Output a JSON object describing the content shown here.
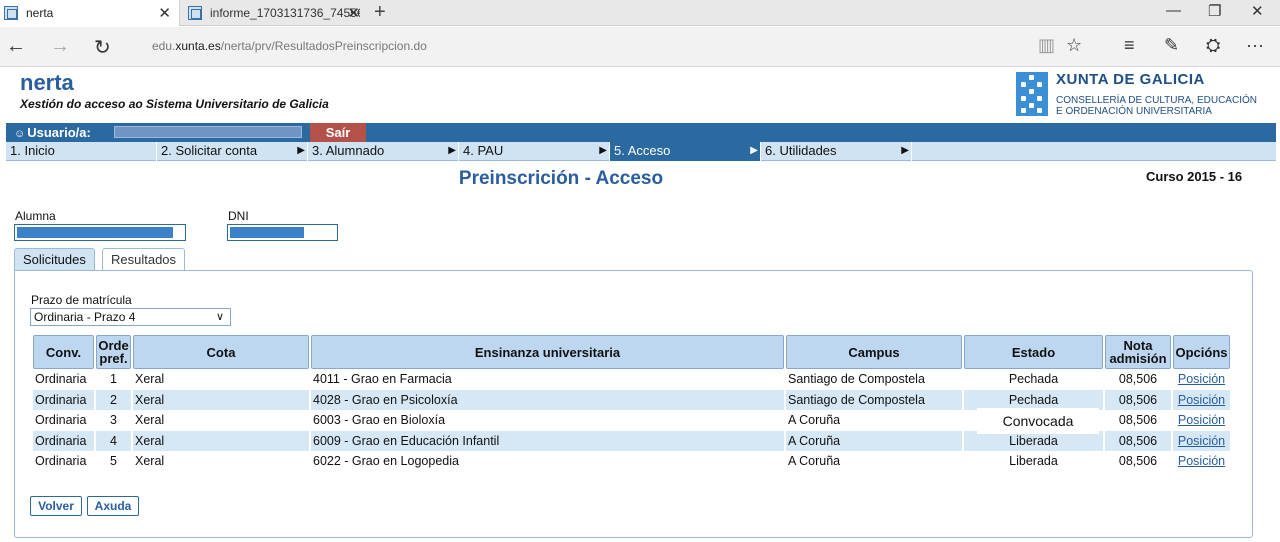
{
  "browser": {
    "tabs": [
      {
        "title": "nerta",
        "active": true
      },
      {
        "title": "informe_1703131736_7455€",
        "active": false
      }
    ],
    "url_prefix": "edu.",
    "url_domain": "xunta.es",
    "url_path": "/nerta/prv/ResultadosPreinscripcion.do",
    "new_tab": "+",
    "back": "←",
    "forward": "→",
    "refresh": "↻",
    "minimize": "—",
    "restore": "❐",
    "close": "✕",
    "reading_view": "▥",
    "favorite": "☆",
    "hub": "≡",
    "notes": "✎",
    "share": "⛭",
    "more": "···"
  },
  "header": {
    "app_name": "nerta",
    "app_subtitle": "Xestión do acceso ao Sistema Universitario de Galicia",
    "org_name": "XUNTA DE GALICIA",
    "dept_line1": "CONSELLERÍA DE CULTURA, EDUCACIÓN",
    "dept_line2": "E ORDENACIÓN UNIVERSITARIA"
  },
  "userbar": {
    "user_label": "Usuario/a:",
    "logout_label": "Saír"
  },
  "menu": [
    {
      "label": "1. Inicio",
      "arrow": false,
      "active": false
    },
    {
      "label": "2. Solicitar conta",
      "arrow": true,
      "active": false
    },
    {
      "label": "3. Alumnado",
      "arrow": true,
      "active": false
    },
    {
      "label": "4. PAU",
      "arrow": true,
      "active": false
    },
    {
      "label": "5. Acceso",
      "arrow": true,
      "active": true
    },
    {
      "label": "6. Utilidades",
      "arrow": true,
      "active": false
    }
  ],
  "page": {
    "title": "Preinscrición - Acceso",
    "curso": "Curso 2015 - 16",
    "alumna_label": "Alumna",
    "dni_label": "DNI"
  },
  "tabs": [
    {
      "label": "Solicitudes",
      "active": false
    },
    {
      "label": "Resultados",
      "active": true
    }
  ],
  "prazo": {
    "label": "Prazo de matrícula",
    "selected": "Ordinaria - Prazo 4"
  },
  "table": {
    "headers": {
      "conv": "Conv.",
      "orde": "Orde pref.",
      "cota": "Cota",
      "ensinanza": "Ensinanza universitaria",
      "campus": "Campus",
      "estado": "Estado",
      "nota": "Nota admisión",
      "opcions": "Opcións"
    },
    "rows": [
      {
        "conv": "Ordinaria",
        "orde": "1",
        "cota": "Xeral",
        "ensinanza": "4011 - Grao en Farmacia",
        "campus": "Santiago de Compostela",
        "estado": "Pechada",
        "nota": "08,506",
        "opcion": "Posición"
      },
      {
        "conv": "Ordinaria",
        "orde": "2",
        "cota": "Xeral",
        "ensinanza": "4028 - Grao en Psicoloxía",
        "campus": "Santiago de Compostela",
        "estado": "Pechada",
        "nota": "08,506",
        "opcion": "Posición"
      },
      {
        "conv": "Ordinaria",
        "orde": "3",
        "cota": "Xeral",
        "ensinanza": "6003 - Grao en Bioloxía",
        "campus": "A Coruña",
        "estado": "",
        "nota": "08,506",
        "opcion": "Posición"
      },
      {
        "conv": "Ordinaria",
        "orde": "4",
        "cota": "Xeral",
        "ensinanza": "6009 - Grao en Educación Infantil",
        "campus": "A Coruña",
        "estado": "Liberada",
        "nota": "08,506",
        "opcion": "Posición"
      },
      {
        "conv": "Ordinaria",
        "orde": "5",
        "cota": "Xeral",
        "ensinanza": "6022 - Grao en Logopedia",
        "campus": "A Coruña",
        "estado": "Liberada",
        "nota": "08,506",
        "opcion": "Posición"
      }
    ],
    "overlay_estado": "Convocada"
  },
  "buttons": {
    "back": "Volver",
    "help": "Axuda"
  }
}
